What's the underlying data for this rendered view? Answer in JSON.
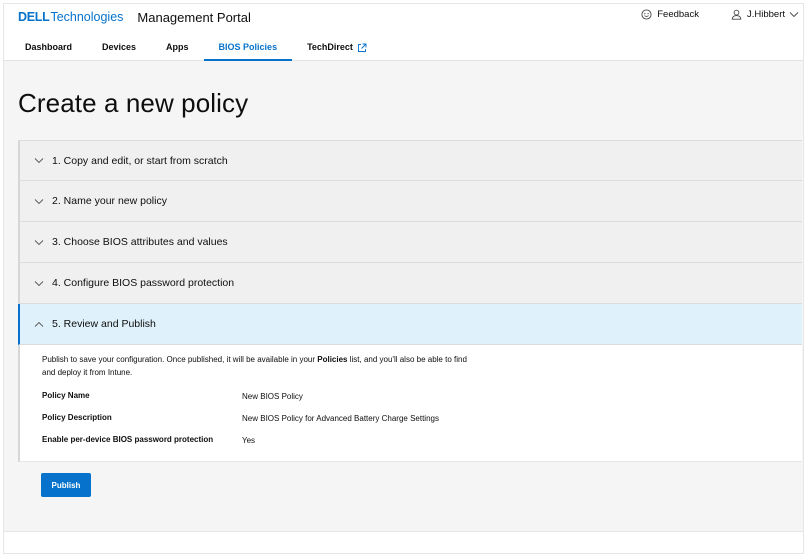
{
  "header": {
    "brand_dell": "DELL",
    "brand_tech": "Technologies",
    "portal_title": "Management Portal",
    "feedback_label": "Feedback",
    "user_name": "J.Hibbert"
  },
  "tabs": [
    {
      "label": "Dashboard",
      "active": false
    },
    {
      "label": "Devices",
      "active": false
    },
    {
      "label": "Apps",
      "active": false
    },
    {
      "label": "BIOS Policies",
      "active": true
    },
    {
      "label": "TechDirect",
      "active": false,
      "external": true
    }
  ],
  "page": {
    "title": "Create a new policy"
  },
  "steps": [
    {
      "label": "1. Copy and edit, or start from scratch",
      "expanded": false
    },
    {
      "label": "2. Name your new policy",
      "expanded": false
    },
    {
      "label": "3. Choose BIOS attributes and values",
      "expanded": false
    },
    {
      "label": "4. Configure BIOS password protection",
      "expanded": false
    },
    {
      "label": "5. Review and Publish",
      "expanded": true
    }
  ],
  "review": {
    "desc_before": "Publish to save your configuration. Once published, it will be available in your ",
    "desc_bold": "Policies",
    "desc_after": " list, and you'll also be able to find and deploy it from Intune.",
    "rows": [
      {
        "key": "Policy Name",
        "value": "New BIOS Policy"
      },
      {
        "key": "Policy Description",
        "value": "New BIOS Policy for Advanced Battery Charge Settings"
      },
      {
        "key": "Enable per-device BIOS password protection",
        "value": "Yes"
      }
    ],
    "publish_label": "Publish"
  },
  "colors": {
    "accent": "#0672cb",
    "expanded_bg": "#dff2fb"
  },
  "icons": {
    "feedback": "feedback-icon",
    "user": "user-icon",
    "external": "external-link-icon",
    "collapsed": "chevron-down-icon",
    "expanded": "chevron-up-icon"
  }
}
